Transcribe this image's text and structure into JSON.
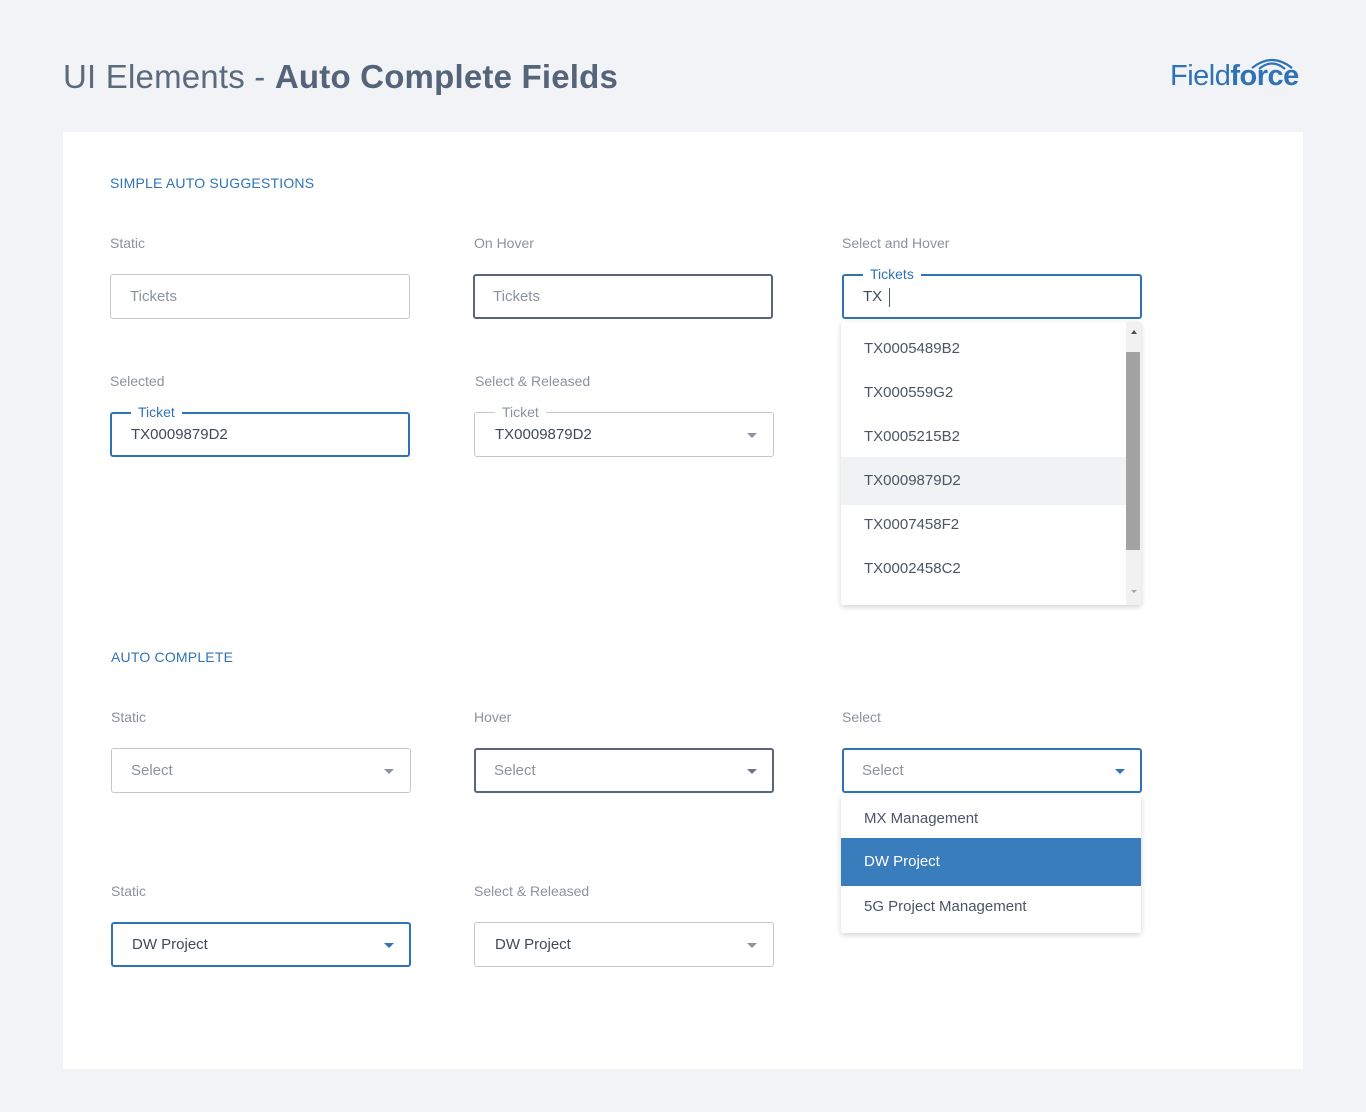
{
  "header": {
    "title_prefix": "UI Elements - ",
    "title_bold": "Auto Complete Fields",
    "logo_thin": "Field",
    "logo_bold": "force"
  },
  "colors": {
    "accent": "#2f73b6",
    "selected_bg": "#3a7dbd",
    "page_bg": "#f1f3f6"
  },
  "simple": {
    "section_title": "SIMPLE AUTO SUGGESTIONS",
    "static": {
      "label": "Static",
      "placeholder": "Tickets"
    },
    "on_hover": {
      "label": "On Hover",
      "placeholder": "Tickets"
    },
    "select_hover": {
      "label": "Select and Hover",
      "legend": "Tickets",
      "value": "TX",
      "options": [
        "TX0005489B2",
        "TX000559G2",
        "TX0005215B2",
        "TX0009879D2",
        "TX0007458F2",
        "TX0002458C2"
      ],
      "highlighted": "TX0009879D2"
    },
    "selected": {
      "label": "Selected",
      "legend": "Ticket",
      "value": "TX0009879D2"
    },
    "select_released": {
      "label": "Select & Released",
      "legend": "Ticket",
      "value": "TX0009879D2"
    }
  },
  "auto": {
    "section_title": "AUTO COMPLETE",
    "static": {
      "label": "Static",
      "placeholder": "Select"
    },
    "hover": {
      "label": "Hover",
      "placeholder": "Select"
    },
    "select": {
      "label": "Select",
      "placeholder": "Select",
      "options": [
        "MX Management",
        "DW Project",
        "5G Project Management"
      ],
      "selected": "DW Project"
    },
    "static2": {
      "label": "Static",
      "value": "DW Project"
    },
    "select_released": {
      "label": "Select & Released",
      "value": "DW Project"
    }
  }
}
